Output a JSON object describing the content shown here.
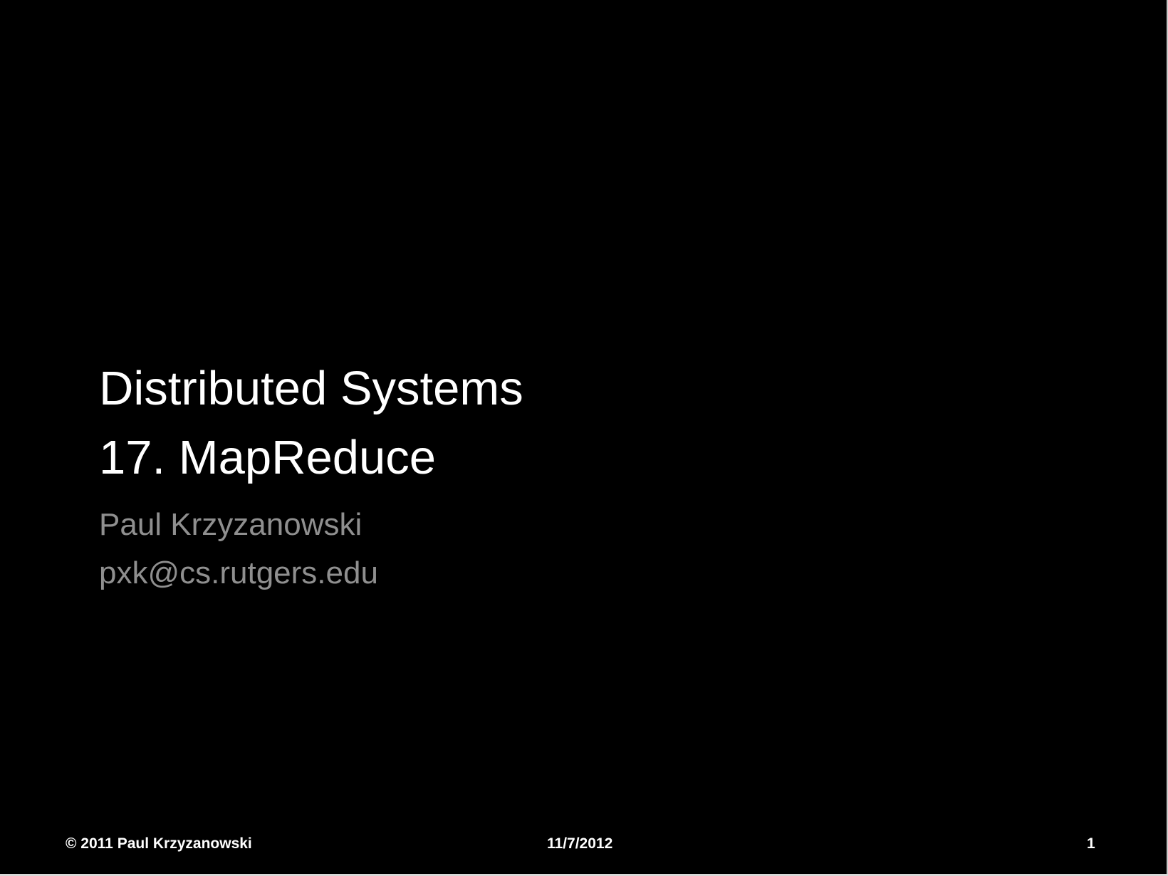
{
  "slide": {
    "title_line_1": "Distributed Systems",
    "title_line_2": "17. MapReduce",
    "author": "Paul Krzyzanowski",
    "email": "pxk@cs.rutgers.edu",
    "footer": {
      "copyright": "© 2011 Paul Krzyzanowski",
      "date": "11/7/2012",
      "page_number": "1"
    }
  },
  "colors": {
    "background": "#000000",
    "title": "#ffffff",
    "subtitle": "#8f8f8f",
    "footer": "#ffffff"
  }
}
